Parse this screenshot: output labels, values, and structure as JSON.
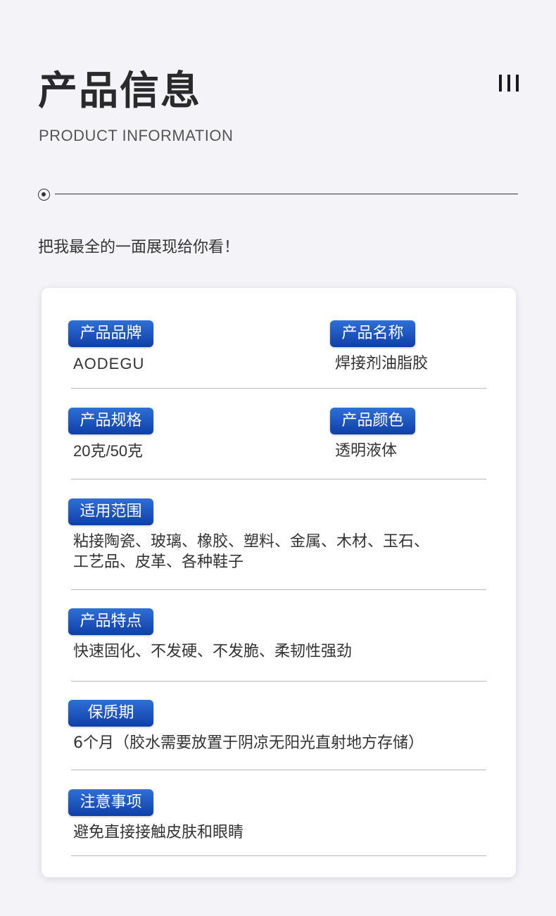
{
  "header": {
    "title": "产品信息",
    "subtitle": "PRODUCT INFORMATION",
    "tagline": "把我最全的一面展现给你看！"
  },
  "specs": {
    "brand": {
      "label": "产品品牌",
      "value": "AODEGU"
    },
    "name": {
      "label": "产品名称",
      "value": "焊接剂油脂胶"
    },
    "size": {
      "label": "产品规格",
      "value": "20克/50克"
    },
    "color": {
      "label": "产品颜色",
      "value": "透明液体"
    },
    "usage": {
      "label": "适用范围",
      "line1": "粘接陶瓷、玻璃、橡胶、塑料、金属、木材、玉石、",
      "line2": "工艺品、皮革、各种鞋子"
    },
    "features": {
      "label": "产品特点",
      "value": "快速固化、不发硬、不发脆、柔韧性强劲"
    },
    "shelf_life": {
      "label": "保质期",
      "value": "6个月（胶水需要放置于阴凉无阳光直射地方存储）"
    },
    "notes": {
      "label": "注意事项",
      "value": "避免直接接触皮肤和眼睛"
    }
  },
  "colors": {
    "badge_top": "#2e6fd6",
    "badge_bottom": "#0f3fa8",
    "background": "#f4f4f8"
  }
}
